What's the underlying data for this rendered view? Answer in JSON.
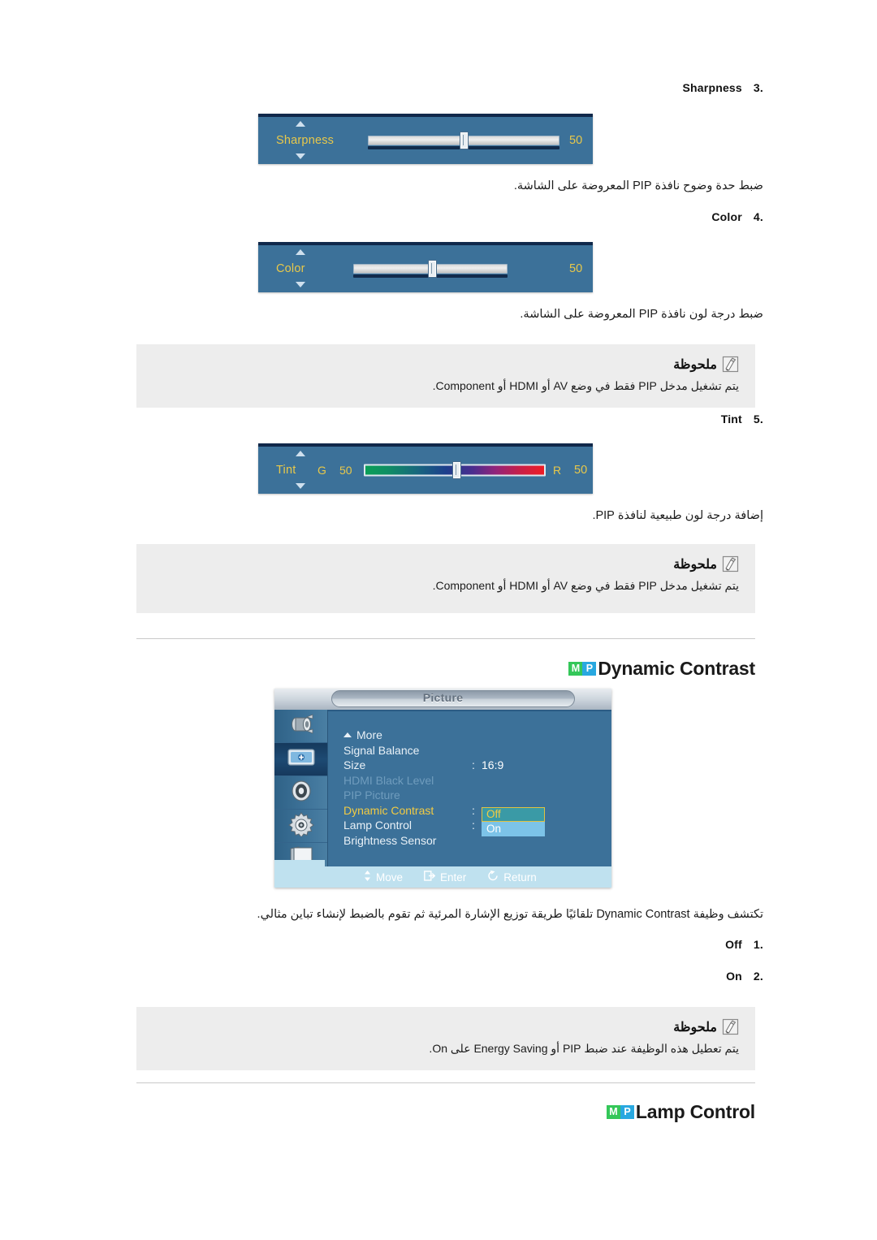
{
  "items": [
    {
      "number": ".3",
      "label": "Sharpness",
      "description": "ضبط حدة وضوح نافذة PIP المعروضة على الشاشة.",
      "slider": {
        "label": "Sharpness",
        "value": "50",
        "type": "plain"
      }
    },
    {
      "number": ".4",
      "label": "Color",
      "description": "ضبط درجة لون نافذة PIP المعروضة على الشاشة.",
      "slider": {
        "label": "Color",
        "value": "50",
        "type": "plain"
      }
    },
    {
      "number": ".5",
      "label": "Tint",
      "description": "إضافة درجة لون طبيعية لنافذة PIP.",
      "slider": {
        "label": "Tint",
        "left_label": "G",
        "left_value": "50",
        "right_label": "R",
        "right_value": "50",
        "type": "gradient"
      }
    }
  ],
  "notes": [
    {
      "title": "ملحوظة",
      "body": "يتم تشغيل مدخل PIP فقط في وضع AV أو HDMI أو Component."
    },
    {
      "title": "ملحوظة",
      "body": "يتم تشغيل مدخل PIP فقط في وضع AV أو HDMI أو Component."
    },
    {
      "title": "ملحوظة",
      "body": "يتم تعطيل هذه الوظيفة عند ضبط PIP أو Energy Saving على On."
    }
  ],
  "sections": [
    {
      "badge_m": "M",
      "badge_p": "P",
      "title": "Dynamic Contrast"
    },
    {
      "badge_m": "M",
      "badge_p": "P",
      "title": "Lamp Control"
    }
  ],
  "dynamic_contrast": {
    "description": "تكتشف وظيفة Dynamic Contrast تلقائيًا طريقة توزيع الإشارة المرئية ثم تقوم بالضبط لإنشاء تباين مثالي.",
    "options": [
      {
        "number": ".1",
        "label": "Off"
      },
      {
        "number": ".2",
        "label": "On"
      }
    ]
  },
  "osd_menu": {
    "title": "Picture",
    "rows": [
      {
        "name": "More",
        "value": "",
        "colon": "",
        "state": "normal",
        "caret": true
      },
      {
        "name": "Signal Balance",
        "value": "",
        "colon": "",
        "state": "normal",
        "caret": false
      },
      {
        "name": "Size",
        "value": "16:9",
        "colon": ":",
        "state": "normal",
        "caret": false
      },
      {
        "name": "HDMI Black Level",
        "value": "",
        "colon": "",
        "state": "dim",
        "caret": false
      },
      {
        "name": "PIP Picture",
        "value": "",
        "colon": "",
        "state": "dim",
        "caret": false
      },
      {
        "name": "Dynamic Contrast",
        "value": "",
        "colon": ":",
        "state": "selected",
        "caret": false
      },
      {
        "name": "Lamp Control",
        "value": "",
        "colon": ":",
        "state": "normal",
        "caret": false
      },
      {
        "name": "Brightness Sensor",
        "value": "",
        "colon": "",
        "state": "normal",
        "caret": false
      }
    ],
    "dropdown": {
      "off": "Off",
      "on": "On"
    },
    "sidebar_icons": [
      "input-source-icon",
      "picture-icon",
      "sound-icon",
      "setup-gear-icon",
      "multi-control-icon"
    ],
    "footer": [
      {
        "icon": "move-updown-icon",
        "label": "Move"
      },
      {
        "icon": "enter-icon",
        "label": "Enter"
      },
      {
        "icon": "return-icon",
        "label": "Return"
      }
    ]
  },
  "colors": {
    "osd_blue": "#3c7199",
    "osd_yellow": "#e8c84a",
    "badge_green": "#34c759",
    "badge_blue": "#28a8e0",
    "note_bg": "#ededed"
  }
}
